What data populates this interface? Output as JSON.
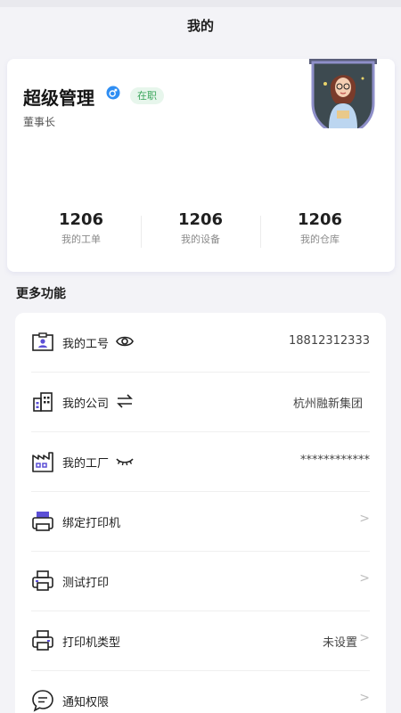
{
  "header": {
    "title": "我的"
  },
  "profile": {
    "name": "超级管理",
    "status": "在职",
    "role": "董事长",
    "gender_icon": "male-icon",
    "avatar_icon": "avatar-illustration"
  },
  "stats": [
    {
      "value": "1206",
      "label": "我的工单"
    },
    {
      "value": "1206",
      "label": "我的设备"
    },
    {
      "value": "1206",
      "label": "我的仓库"
    }
  ],
  "section": {
    "title": "更多功能"
  },
  "menu": [
    {
      "icon": "id-card-icon",
      "label": "我的工号",
      "extra_icon": "eye-icon",
      "value": "18812312333",
      "arrow": ""
    },
    {
      "icon": "building-icon",
      "label": "我的公司",
      "extra_icon": "switch-arrows-icon",
      "value": "杭州融新集团",
      "arrow": ""
    },
    {
      "icon": "factory-icon",
      "label": "我的工厂",
      "extra_icon": "eye-closed-icon",
      "value": "************",
      "arrow": ""
    },
    {
      "icon": "printer-icon",
      "label": "绑定打印机",
      "value": "",
      "arrow": ">"
    },
    {
      "icon": "printer-test-icon",
      "label": "测试打印",
      "value": "",
      "arrow": ">"
    },
    {
      "icon": "printer-type-icon",
      "label": "打印机类型",
      "value": "未设置",
      "arrow": ">"
    },
    {
      "icon": "chat-bubble-icon",
      "label": "通知权限",
      "value": "",
      "arrow": ">"
    }
  ],
  "colors": {
    "accent": "#5b4fd6",
    "badge_bg": "#e7f6ec",
    "badge_text": "#3aa55b"
  }
}
